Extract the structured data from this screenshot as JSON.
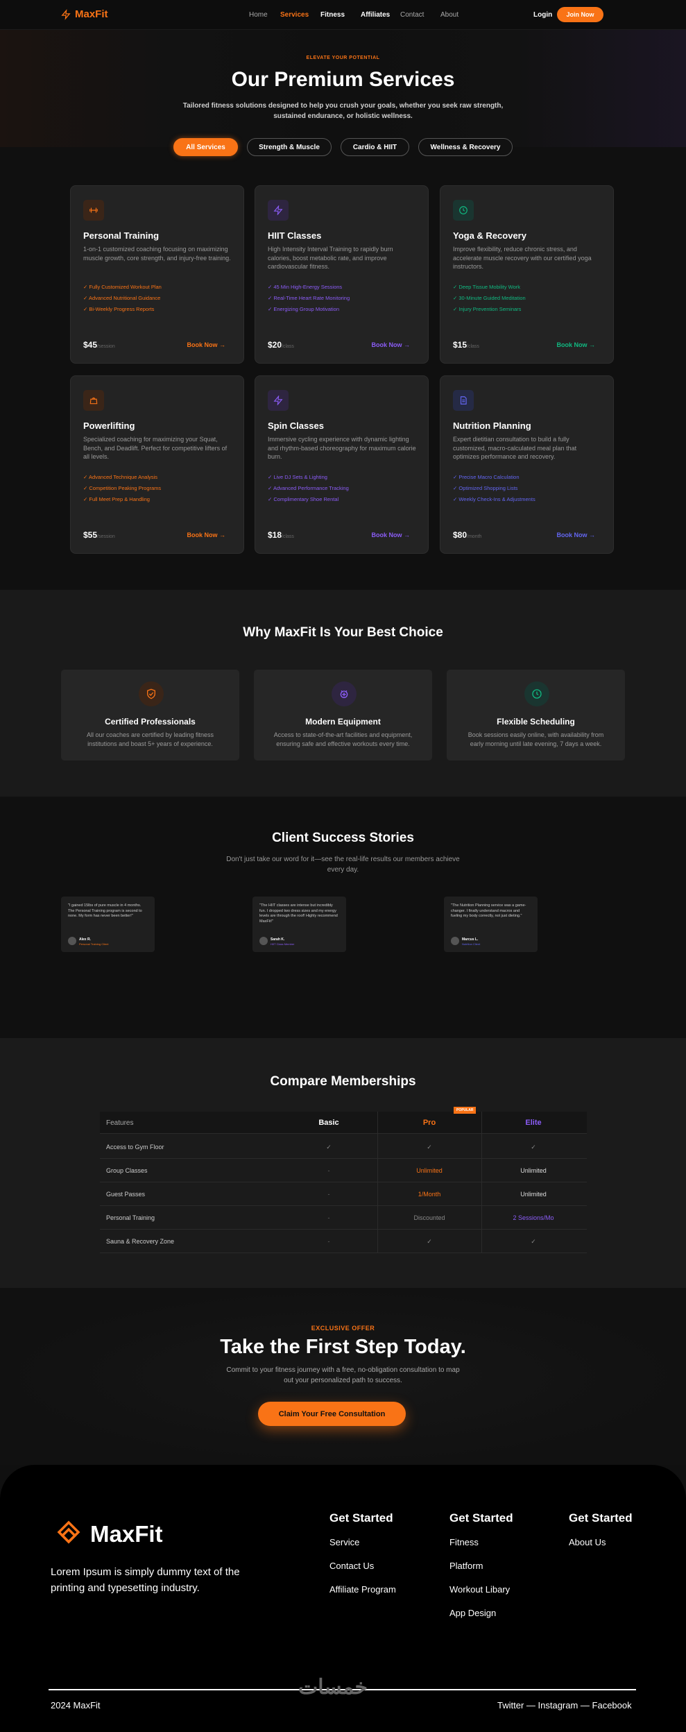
{
  "nav": {
    "brand": "MaxFit",
    "links": [
      "Home",
      "Services",
      "Fitness",
      "Affiliates",
      "Contact",
      "About"
    ],
    "active": "Services",
    "login": "Login",
    "join": "Join Now"
  },
  "hero": {
    "eyebrow": "ELEVATE YOUR POTENTIAL",
    "title": "Our Premium Services",
    "subtitle": "Tailored fitness solutions designed to help you crush your goals, whether you seek raw strength, sustained endurance, or holistic wellness.",
    "filters": [
      "All Services",
      "Strength & Muscle",
      "Cardio & HIIT",
      "Wellness & Recovery"
    ]
  },
  "services": [
    {
      "title": "Personal Training",
      "desc": "1-on-1 customized coaching focusing on maximizing muscle growth, core strength, and injury-free training.",
      "features": [
        "✓ Fully Customized Workout Plan",
        "✓ Advanced Nutritional Guidance",
        "✓ Bi-Weekly Progress Reports"
      ],
      "price": "$45",
      "unit": "/session",
      "cta": "Book Now →",
      "color": "#f97316",
      "icon": "dumbbell-icon"
    },
    {
      "title": "HIIT Classes",
      "desc": "High Intensity Interval Training to rapidly burn calories, boost metabolic rate, and improve cardiovascular fitness.",
      "features": [
        "✓ 45 Min High-Energy Sessions",
        "✓ Real-Time Heart Rate Monitoring",
        "✓ Energizing Group Motivation"
      ],
      "price": "$20",
      "unit": "/class",
      "cta": "Book Now →",
      "color": "#8b5cf6",
      "icon": "bolt-icon"
    },
    {
      "title": "Yoga & Recovery",
      "desc": "Improve flexibility, reduce chronic stress, and accelerate muscle recovery with our certified yoga instructors.",
      "features": [
        "✓ Deep Tissue Mobility Work",
        "✓ 30-Minute Guided Meditation",
        "✓ Injury Prevention Seminars"
      ],
      "price": "$15",
      "unit": "/class",
      "cta": "Book Now →",
      "color": "#10b981",
      "icon": "clock-icon"
    },
    {
      "title": "Powerlifting",
      "desc": "Specialized coaching for maximizing your Squat, Bench, and Deadlift. Perfect for competitive lifters of all levels.",
      "features": [
        "✓ Advanced Technique Analysis",
        "✓ Competition Peaking Programs",
        "✓ Full Meet Prep & Handling"
      ],
      "price": "$55",
      "unit": "/session",
      "cta": "Book Now →",
      "color": "#f97316",
      "icon": "weight-icon"
    },
    {
      "title": "Spin Classes",
      "desc": "Immersive cycling experience with dynamic lighting and rhythm-based choreography for maximum calorie burn.",
      "features": [
        "✓ Live DJ Sets & Lighting",
        "✓ Advanced Performance Tracking",
        "✓ Complimentary Shoe Rental"
      ],
      "price": "$18",
      "unit": "/class",
      "cta": "Book Now →",
      "color": "#8b5cf6",
      "icon": "bolt-icon"
    },
    {
      "title": "Nutrition Planning",
      "desc": "Expert dietitian consultation to build a fully customized, macro-calculated meal plan that optimizes performance and recovery.",
      "features": [
        "✓ Precise Macro Calculation",
        "✓ Optimized Shopping Lists",
        "✓ Weekly Check-Ins & Adjustments"
      ],
      "price": "$80",
      "unit": "/month",
      "cta": "Book Now →",
      "color": "#6366f1",
      "icon": "document-icon"
    }
  ],
  "why": {
    "title": "Why MaxFit Is Your Best Choice",
    "items": [
      {
        "title": "Certified Professionals",
        "desc": "All our coaches are certified by leading fitness institutions and boast 5+ years of experience.",
        "color": "#f97316",
        "icon": "shield-icon"
      },
      {
        "title": "Modern Equipment",
        "desc": "Access to state-of-the-art facilities and equipment, ensuring safe and effective workouts every time.",
        "color": "#8b5cf6",
        "icon": "equipment-icon"
      },
      {
        "title": "Flexible Scheduling",
        "desc": "Book sessions easily online, with availability from early morning until late evening, 7 days a week.",
        "color": "#10b981",
        "icon": "clock-icon"
      }
    ]
  },
  "stories": {
    "title": "Client Success Stories",
    "subtitle": "Don't just take our word for it—see the real-life results our members achieve every day.",
    "items": [
      {
        "quote": "\"I gained 15lbs of pure muscle in 4 months. The Personal Training program is second to none. My form has never been better!\"",
        "name": "Alex R.",
        "role": "Personal Training Client",
        "color": "#f97316"
      },
      {
        "quote": "\"The HIIT classes are intense but incredibly fun. I dropped two dress sizes and my energy levels are through the roof! Highly recommend MaxFit!\"",
        "name": "Sarah K.",
        "role": "HIIT Class Member",
        "color": "#8b5cf6"
      },
      {
        "quote": "\"The Nutrition Planning service was a game-changer. I finally understand macros and fueling my body correctly, not just dieting.\"",
        "name": "Marcus L.",
        "role": "Nutrition Client",
        "color": "#6366f1"
      }
    ]
  },
  "compare": {
    "title": "Compare Memberships",
    "headers": [
      "Features",
      "Basic",
      "Pro",
      "Elite"
    ],
    "popular": "POPULAR",
    "rows": [
      [
        "Access to Gym Floor",
        "✓",
        "✓",
        "✓"
      ],
      [
        "Group Classes",
        "-",
        "Unlimited",
        "Unlimited"
      ],
      [
        "Guest Passes",
        "-",
        "1/Month",
        "Unlimited"
      ],
      [
        "Personal Training",
        "-",
        "Discounted",
        "2 Sessions/Mo"
      ],
      [
        "Sauna & Recovery Zone",
        "-",
        "✓",
        "✓"
      ]
    ]
  },
  "cta": {
    "eyebrow": "EXCLUSIVE OFFER",
    "title": "Take the First Step Today.",
    "subtitle": "Commit to your fitness journey with a free, no-obligation consultation to map out your personalized path to success.",
    "button": "Claim Your Free Consultation"
  },
  "footer": {
    "brand": "MaxFit",
    "tagline": "Lorem Ipsum is simply dummy text of the printing and typesetting industry.",
    "columns": [
      {
        "title": "Get Started",
        "links": [
          "Service",
          "Contact Us",
          "Affiliate Program"
        ]
      },
      {
        "title": "Get Started",
        "links": [
          "Fitness",
          "Platform",
          "Workout Libary",
          "App Design"
        ]
      },
      {
        "title": "Get Started",
        "links": [
          "About Us"
        ]
      }
    ],
    "watermark": "خمسات",
    "copyright": "2024 MaxFit",
    "social": "Twitter  —  Instagram — Facebook"
  }
}
